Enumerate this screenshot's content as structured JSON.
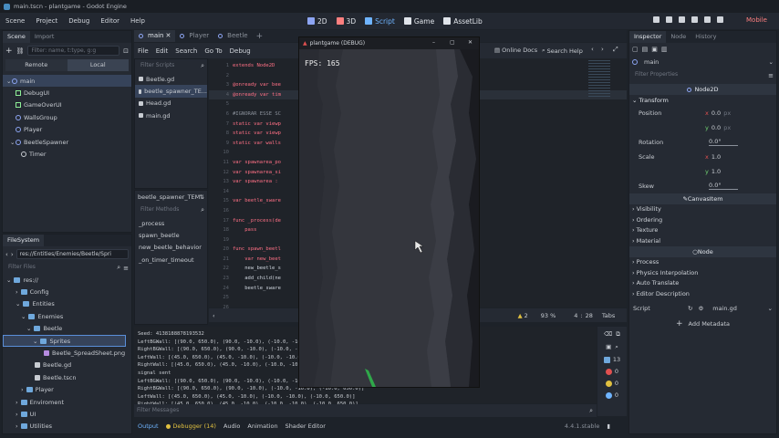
{
  "window": {
    "title": "main.tscn - plantgame - Godot Engine"
  },
  "menu": [
    "Scene",
    "Project",
    "Debug",
    "Editor",
    "Help"
  ],
  "workspaces": [
    {
      "label": "2D"
    },
    {
      "label": "3D"
    },
    {
      "label": "Script"
    },
    {
      "label": "Game"
    },
    {
      "label": "AssetLib"
    }
  ],
  "renderer": "Mobile",
  "scene_dock": {
    "tabs": [
      "Scene",
      "Import"
    ],
    "filter_placeholder": "Filter: name, t:type, g:g",
    "remote": "Remote",
    "local": "Local",
    "nodes": [
      "main",
      "DebugUI",
      "GameOverUI",
      "WallsGroup",
      "Player",
      "BeetleSpawner",
      "Timer"
    ]
  },
  "filesystem": {
    "title": "FileSystem",
    "path": "res://Entities/Enemies/Beetle/Spri",
    "filter": "Filter Files",
    "items": [
      "res://",
      "Config",
      "Entities",
      "Enemies",
      "Beetle",
      "Sprites",
      "Beetle_SpreadSheet.png",
      "Beetle.gd",
      "Beetle.tscn",
      "Player",
      "Enviroment",
      "UI",
      "Utilities"
    ]
  },
  "editor_tabs": [
    "main",
    "Player",
    "Beetle"
  ],
  "script_menu": [
    "File",
    "Edit",
    "Search",
    "Go To",
    "Debug"
  ],
  "script_tools": {
    "docs": "Online Docs",
    "search_help": "Search Help"
  },
  "scripts": {
    "filter": "Filter Scripts",
    "items": [
      "Beetle.gd",
      "beetle_spawner_TE...",
      "Head.gd",
      "main.gd"
    ],
    "current": "beetle_spawner_TEM"
  },
  "methods": {
    "filter": "Filter Methods",
    "items": [
      "_process",
      "spawn_beetle",
      "new_beetle_behavior",
      "_on_timer_timeout"
    ]
  },
  "code": {
    "lines": [
      {
        "n": "1",
        "t": "extends Node2D"
      },
      {
        "n": "2",
        "t": ""
      },
      {
        "n": "3",
        "t": "@onready var bee"
      },
      {
        "n": "4",
        "t": "@onready var tim"
      },
      {
        "n": "5",
        "t": ""
      },
      {
        "n": "6",
        "t": "#IGNORAR ESSE SC"
      },
      {
        "n": "7",
        "t": "static var viewp"
      },
      {
        "n": "8",
        "t": "static var viewp"
      },
      {
        "n": "9",
        "t": "static var walls"
      },
      {
        "n": "10",
        "t": ""
      },
      {
        "n": "11",
        "t": "var spawnarea_po"
      },
      {
        "n": "12",
        "t": "var spawnarea_si"
      },
      {
        "n": "13",
        "t": "var spawnarea :"
      },
      {
        "n": "14",
        "t": ""
      },
      {
        "n": "15",
        "t": "var beetle_sware"
      },
      {
        "n": "16",
        "t": ""
      },
      {
        "n": "17",
        "t": "func _process(de"
      },
      {
        "n": "18",
        "t": "    pass"
      },
      {
        "n": "19",
        "t": ""
      },
      {
        "n": "20",
        "t": "func spawn_beetl"
      },
      {
        "n": "21",
        "t": "    var new_beet"
      },
      {
        "n": "22",
        "t": "    new_beetle_s"
      },
      {
        "n": "23",
        "t": "    add_child(ne"
      },
      {
        "n": "24",
        "t": "    beetle_sware"
      },
      {
        "n": "25",
        "t": ""
      },
      {
        "n": "26",
        "t": ""
      }
    ],
    "status": {
      "warnings": "2",
      "zoom": "93 %",
      "line": "4",
      "col": "28",
      "tabs": "Tabs"
    }
  },
  "game_window": {
    "title": "plantgame (DEBUG)",
    "fps": "FPS: 165"
  },
  "output": {
    "lines": [
      "Seed: 4138188878193532",
      "LeftBGWall: [(90.0, 650.0), (90.0, -10.0), (-10.0, -10.0), (-10.0, 650.0)]",
      "RightBGWall: [(90.0, 650.0), (90.0, -10.0), (-10.0, -10.0), (-10.0, 650.0)]",
      "LeftWall: [(45.0, 650.0), (45.0, -10.0), (-10.0, -10.0), (-10.0, 650.0)]",
      "RightWall: [(45.0, 650.0), (45.0, -10.0), (-10.0, -10.0), (-10.0, 650.0)]",
      "signal sent",
      "LeftBGWall: [(90.0, 650.0), (90.0, -10.0), (-10.0, -10.0), (-10.0, 650.0)]",
      "RightBGWall: [(90.0, 650.0), (90.0, -10.0), (-10.0, -10.0), (-10.0, 650.0)]",
      "LeftWall: [(45.0, 650.0), (45.0, -10.0), (-10.0, -10.0), (-10.0, 650.0)]",
      "RightWall: [(45.0, 650.0), (45.0, -10.0), (-10.0, -10.0), (-10.0, 650.0)]"
    ],
    "filter": "Filter Messages",
    "counts": [
      "13",
      "0",
      "0",
      "0"
    ]
  },
  "bottom_tabs": [
    "Output",
    "Debugger (14)",
    "Audio",
    "Animation",
    "Shader Editor"
  ],
  "version": "4.4.1.stable",
  "inspector": {
    "tabs": [
      "Inspector",
      "Node",
      "History"
    ],
    "node": "main",
    "filter": "Filter Properties",
    "class": "Node2D",
    "transform": "Transform",
    "position_x": "0.0",
    "position_y": "0.0",
    "unit": "px",
    "rotation": "0.0",
    "rotation_unit": "°",
    "scale_x": "1.0",
    "scale_y": "1.0",
    "skew": "0.0",
    "canvas": "CanvasItem",
    "canvas_sections": [
      "Visibility",
      "Ordering",
      "Texture",
      "Material"
    ],
    "node_section": "Node",
    "node_sections": [
      "Process",
      "Physics Interpolation",
      "Auto Translate",
      "Editor Description"
    ],
    "script_label": "Script",
    "script_value": "main.gd",
    "add_metadata": "Add Metadata",
    "labels": {
      "position": "Position",
      "rotation": "Rotation",
      "scale": "Scale",
      "skew": "Skew",
      "x": "x",
      "y": "y"
    }
  }
}
